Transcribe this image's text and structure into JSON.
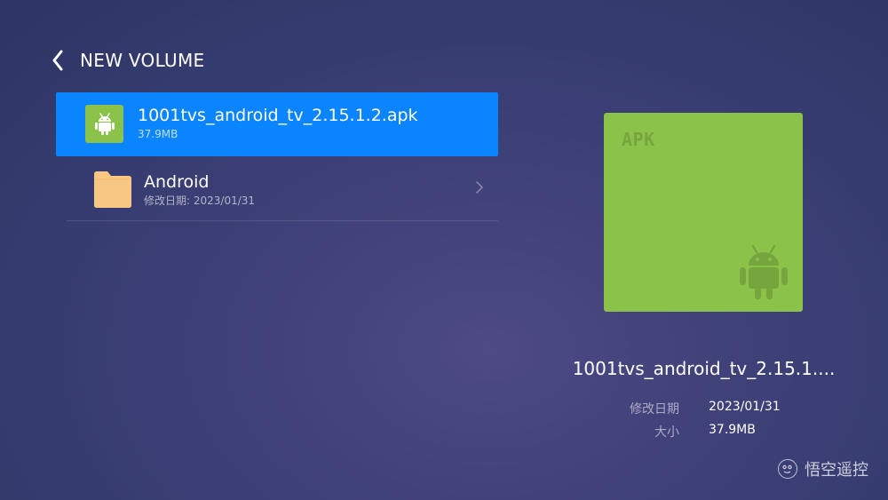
{
  "header": {
    "title": "NEW VOLUME",
    "back_icon": "chevron-left-icon"
  },
  "files": [
    {
      "name": "1001tvs_android_tv_2.15.1.2.apk",
      "meta": "37.9MB",
      "icon": "android-apk-icon",
      "selected": true
    },
    {
      "name": "Android",
      "meta": "修改日期: 2023/01/31",
      "icon": "folder-icon",
      "selected": false
    }
  ],
  "preview": {
    "badge": "APK",
    "title": "1001tvs_android_tv_2.15.1....",
    "details": [
      {
        "label": "修改日期",
        "value": "2023/01/31"
      },
      {
        "label": "大小",
        "value": "37.9MB"
      }
    ]
  },
  "watermark": {
    "text": "悟空遥控"
  },
  "colors": {
    "selection": "#0a84ff",
    "apk_green": "#8bc34a",
    "folder": "#f9c784",
    "background": "#3e4078"
  }
}
